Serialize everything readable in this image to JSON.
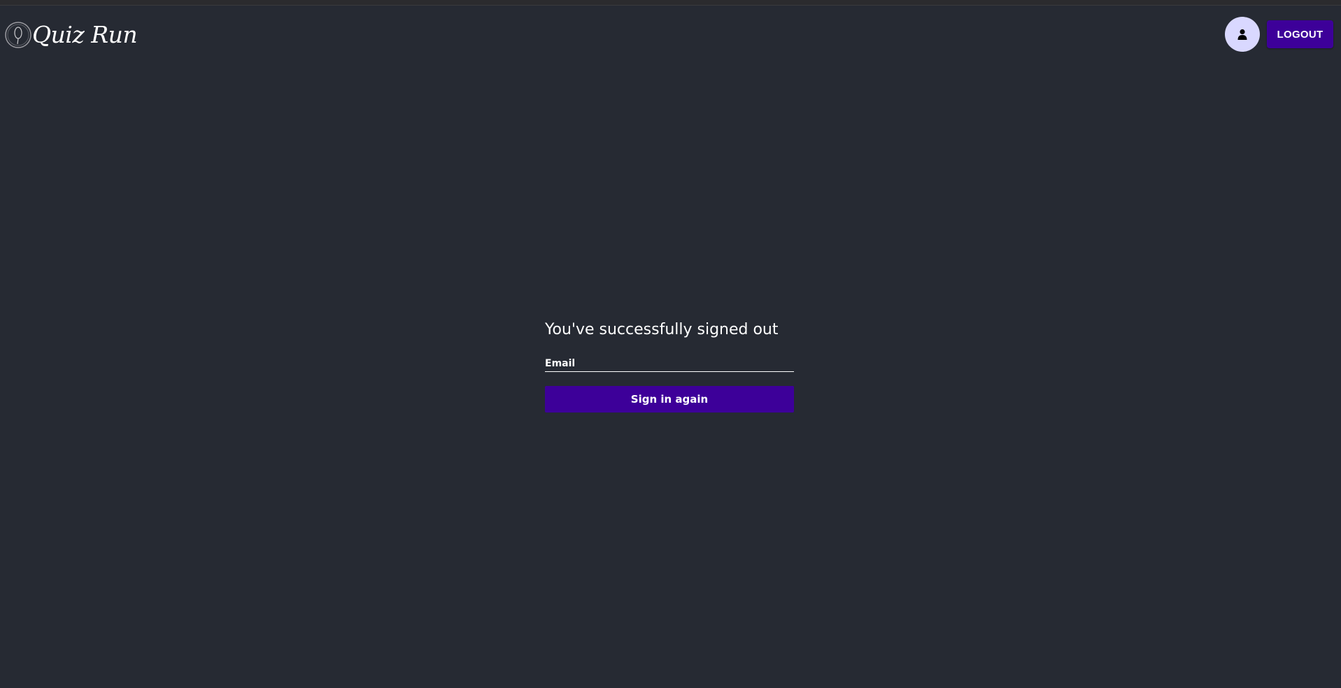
{
  "header": {
    "brand_name": "Quiz Run",
    "logout_label": "LOGOUT",
    "avatar_icon": "user-icon",
    "logo_icon": "quiz-run-logo-icon"
  },
  "signout": {
    "title": "You've successfully signed out",
    "email_placeholder": "Email",
    "email_value": "",
    "signin_label": "Sign in again"
  },
  "colors": {
    "background": "#262a33",
    "accent": "#3d0099",
    "avatar_background": "#d9d8ff",
    "text": "#ffffff"
  }
}
